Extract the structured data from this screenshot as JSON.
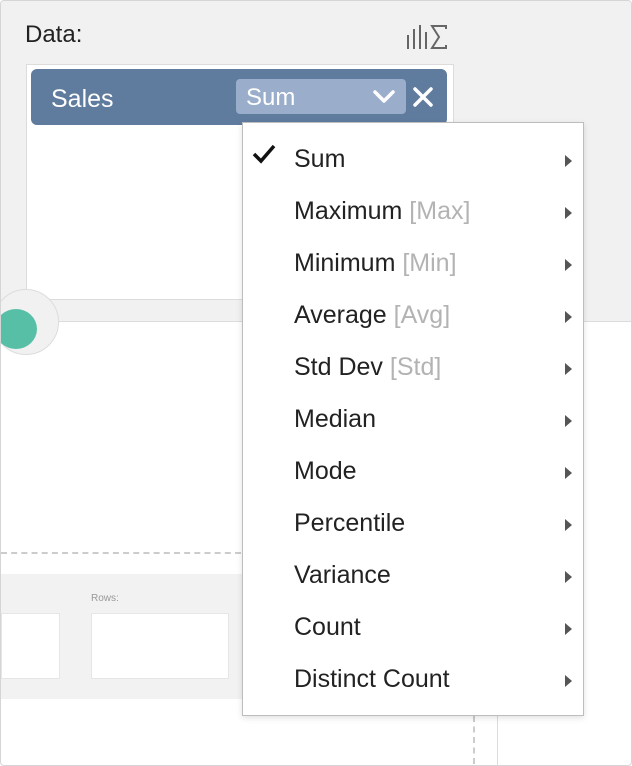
{
  "data_panel": {
    "title": "Data:",
    "field": {
      "label": "Sales",
      "aggregation": "Sum"
    }
  },
  "rows_section": {
    "label": "Rows:"
  },
  "aggregation_menu": {
    "selected": "Sum",
    "items": [
      {
        "label": "Sum",
        "abbr": ""
      },
      {
        "label": "Maximum",
        "abbr": "[Max]"
      },
      {
        "label": "Minimum",
        "abbr": "[Min]"
      },
      {
        "label": "Average",
        "abbr": "[Avg]"
      },
      {
        "label": "Std Dev",
        "abbr": "[Std]"
      },
      {
        "label": "Median",
        "abbr": ""
      },
      {
        "label": "Mode",
        "abbr": ""
      },
      {
        "label": "Percentile",
        "abbr": ""
      },
      {
        "label": "Variance",
        "abbr": ""
      },
      {
        "label": "Count",
        "abbr": ""
      },
      {
        "label": "Distinct Count",
        "abbr": ""
      }
    ]
  },
  "icons": {
    "aggregation": "aggregation-sigma-icon",
    "dropdown": "chevron-down-icon",
    "remove": "close-icon",
    "selected": "checkmark-icon",
    "submenu": "caret-right-icon"
  },
  "colors": {
    "chip": "#5f7b9e",
    "select": "#9aaecb",
    "toggle": "#58bfa7",
    "panel": "#f1f1f1"
  }
}
